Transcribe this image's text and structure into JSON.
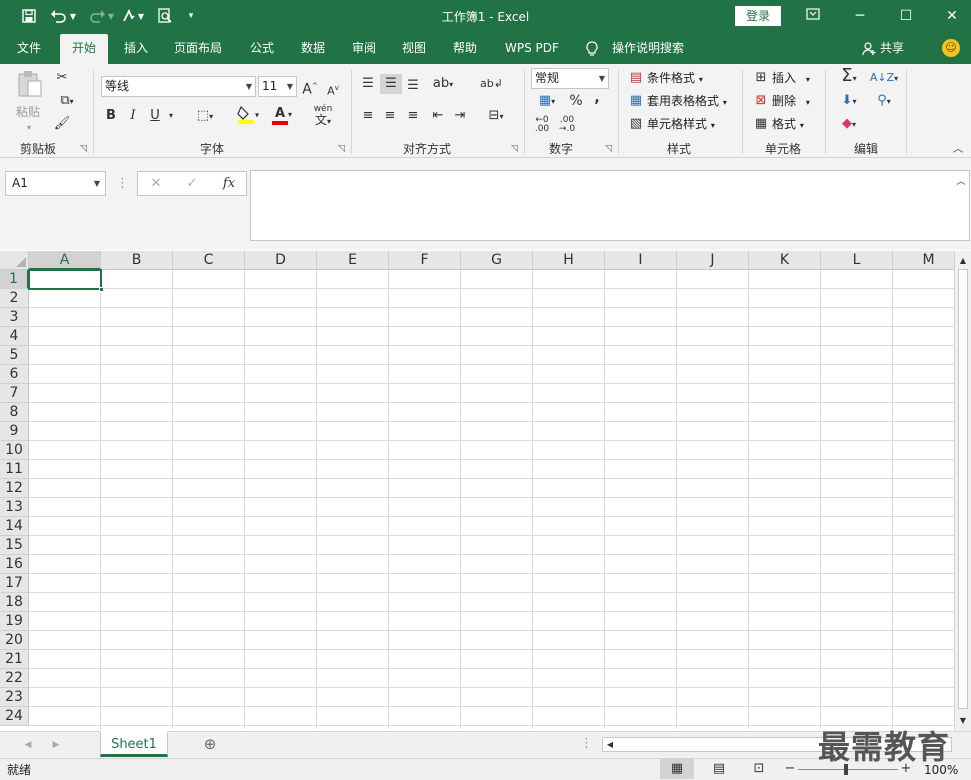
{
  "window": {
    "title": "工作簿1  -  Excel",
    "login_label": "登录",
    "quick_access": [
      "save-icon",
      "undo-icon",
      "redo-icon",
      "touch-mode-icon",
      "print-preview-icon",
      "customize-icon"
    ]
  },
  "tabs": [
    {
      "label": "文件",
      "active": false
    },
    {
      "label": "开始",
      "active": true
    },
    {
      "label": "插入",
      "active": false
    },
    {
      "label": "页面布局",
      "active": false
    },
    {
      "label": "公式",
      "active": false
    },
    {
      "label": "数据",
      "active": false
    },
    {
      "label": "审阅",
      "active": false
    },
    {
      "label": "视图",
      "active": false
    },
    {
      "label": "帮助",
      "active": false
    },
    {
      "label": "WPS PDF",
      "active": false
    }
  ],
  "tell_me": "操作说明搜索",
  "share_label": "共享",
  "ribbon": {
    "clipboard": {
      "label": "剪贴板",
      "paste_label": "粘贴"
    },
    "font": {
      "label": "字体",
      "font_name": "等线",
      "font_size": "11",
      "grow": "A",
      "shrink": "A",
      "bold": "B",
      "italic": "I",
      "underline": "U",
      "font_color_letter": "A",
      "phonetic": "wén"
    },
    "alignment": {
      "label": "对齐方式"
    },
    "number": {
      "label": "数字",
      "format": "常规",
      "percent": "%",
      "comma": ","
    },
    "styles": {
      "label": "样式",
      "conditional": "条件格式",
      "table": "套用表格格式",
      "cell_styles": "单元格样式"
    },
    "cells": {
      "label": "单元格",
      "insert": "插入",
      "delete": "删除",
      "format": "格式"
    },
    "editing": {
      "label": "编辑",
      "sum": "Σ"
    }
  },
  "formula_bar": {
    "name_box": "A1",
    "cancel": "✕",
    "enter": "✓",
    "fx": "fx",
    "value": ""
  },
  "grid": {
    "columns": [
      "A",
      "B",
      "C",
      "D",
      "E",
      "F",
      "G",
      "H",
      "I",
      "J",
      "K",
      "L",
      "M"
    ],
    "rows": [
      "1",
      "2",
      "3",
      "4",
      "5",
      "6",
      "7",
      "8",
      "9",
      "10",
      "11",
      "12",
      "13",
      "14",
      "15",
      "16",
      "17",
      "18",
      "19",
      "20",
      "21",
      "22",
      "23",
      "24"
    ],
    "selected_cell": "A1"
  },
  "sheets": [
    {
      "name": "Sheet1",
      "active": true
    }
  ],
  "status": {
    "mode": "就绪",
    "zoom": "100%"
  },
  "watermark": "最需教育"
}
